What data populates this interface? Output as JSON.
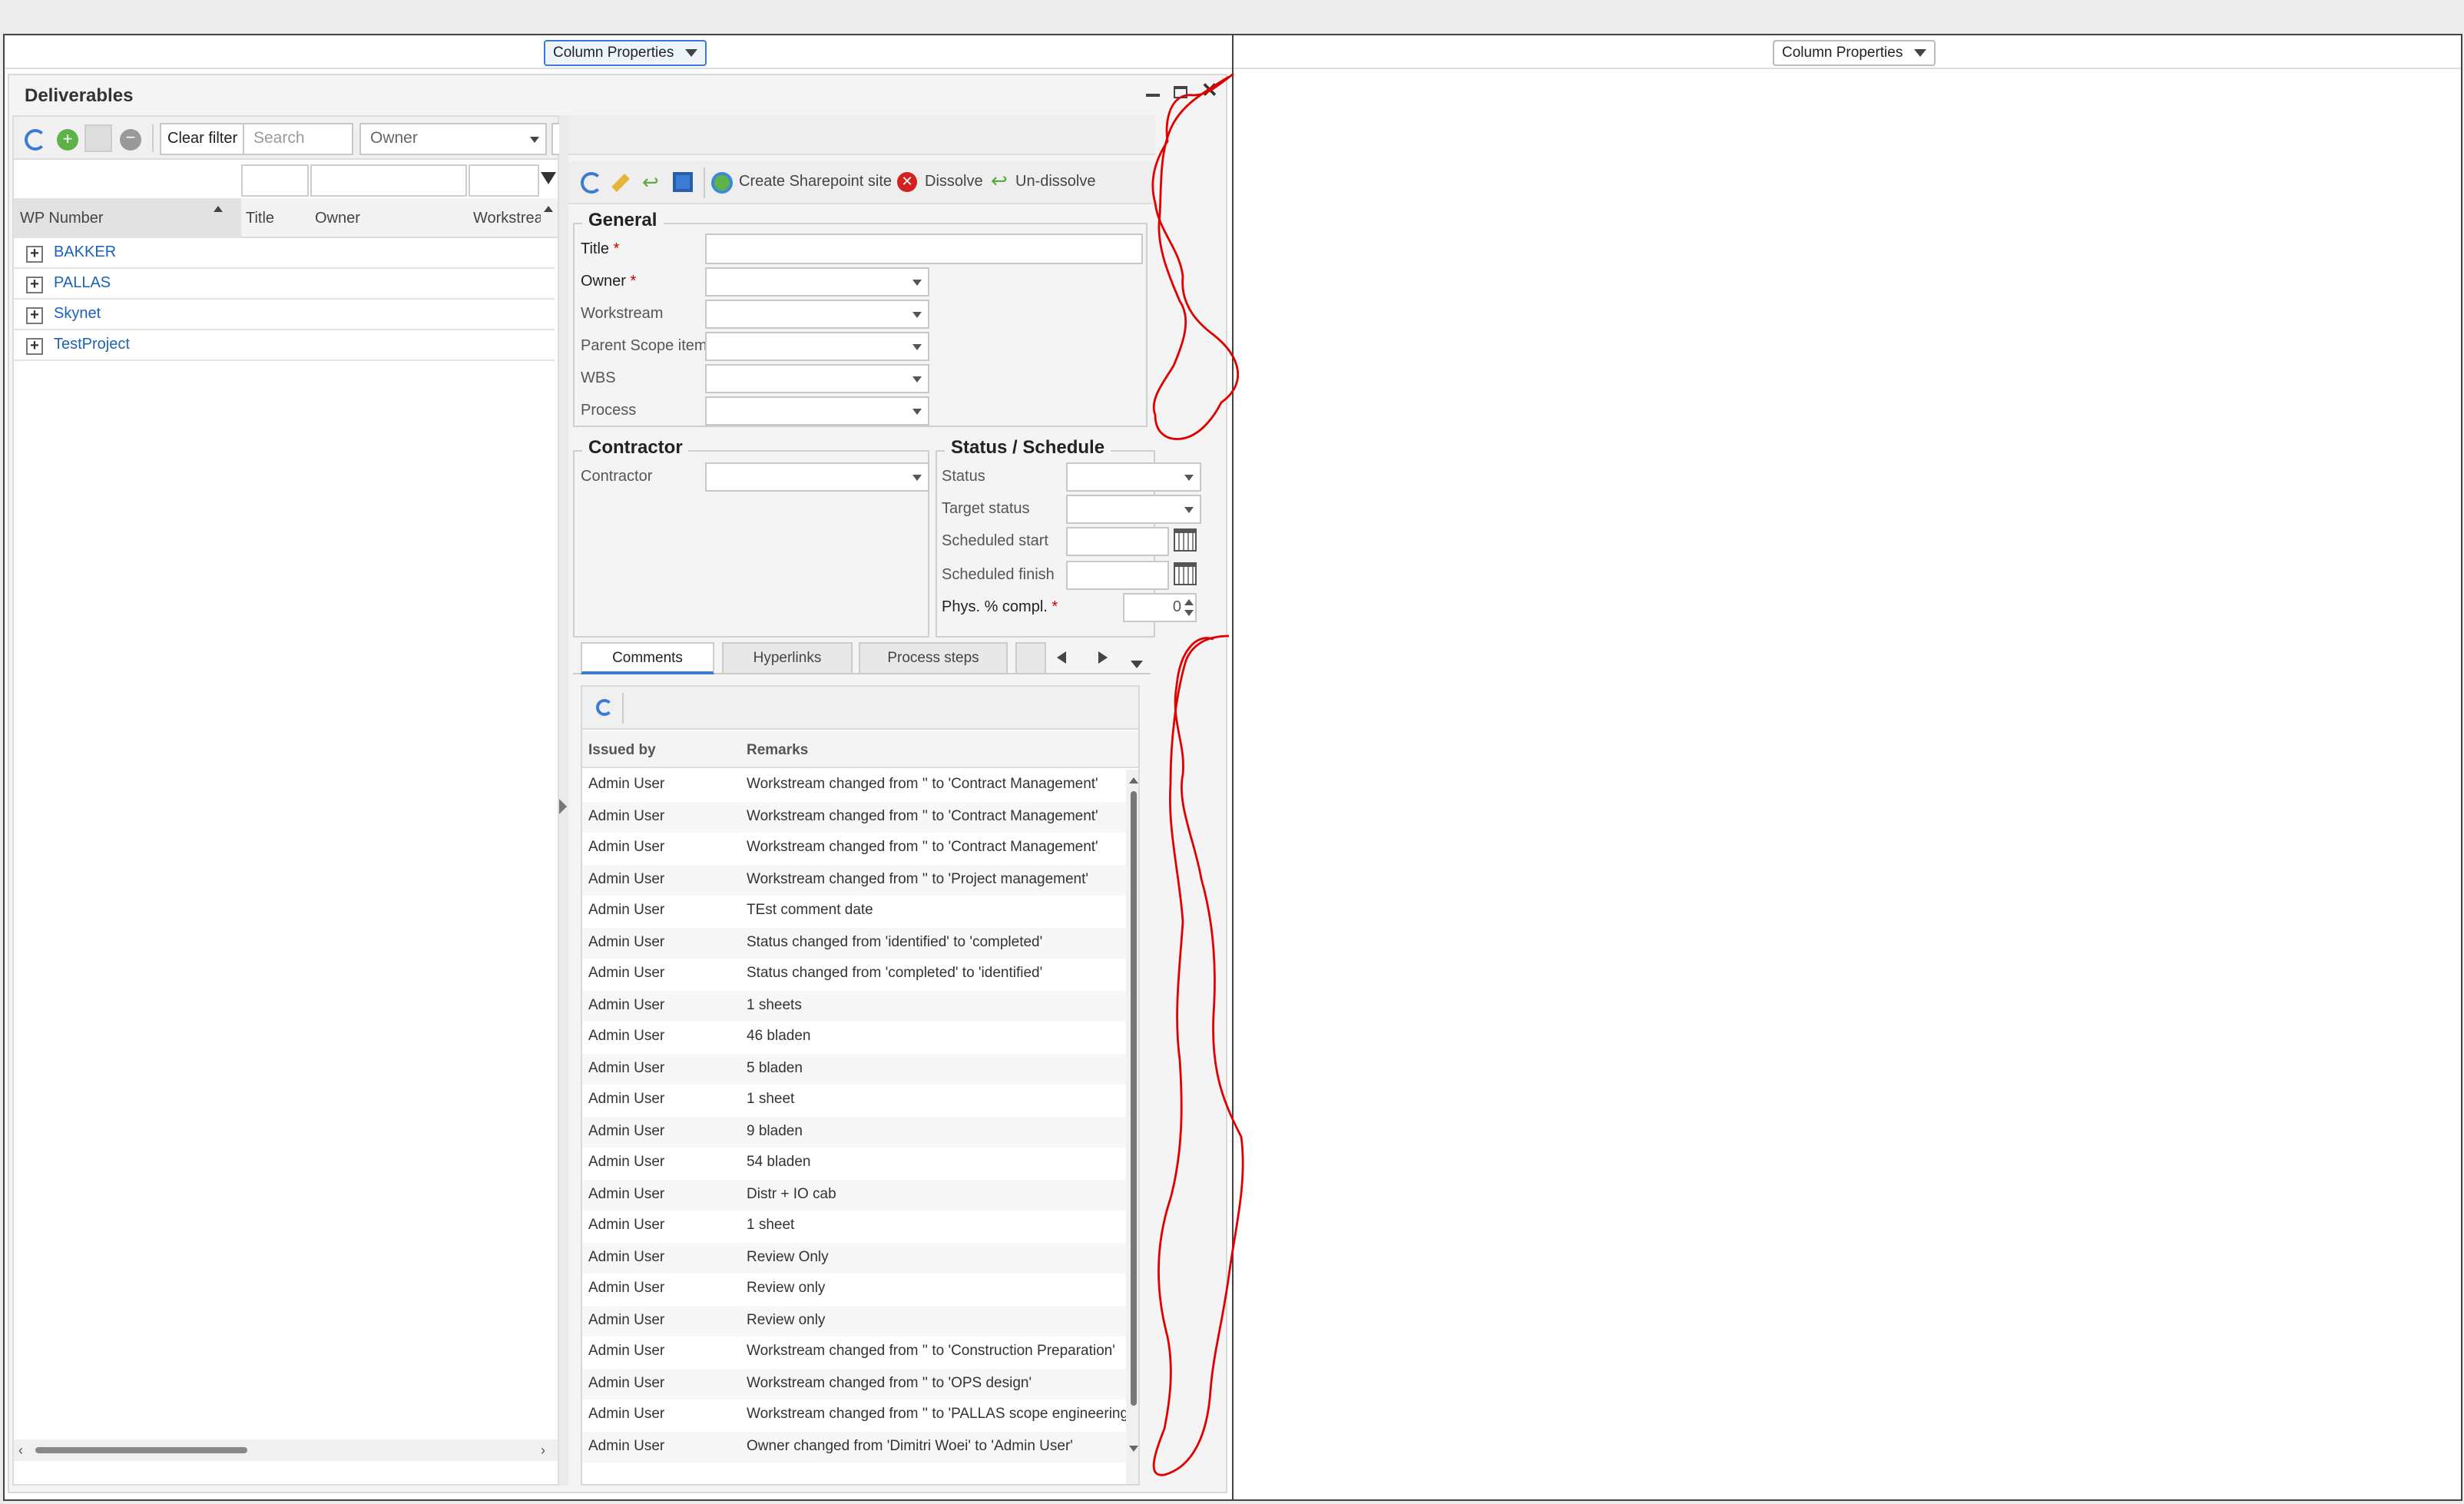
{
  "panels": {
    "left_column_properties": "Column Properties",
    "right_column_properties": "Column Properties"
  },
  "window": {
    "title": "Deliverables"
  },
  "list_toolbar": {
    "clear_filter": "Clear filter",
    "search_placeholder": "Search",
    "owner_filter": "Owner"
  },
  "tree": {
    "columns": [
      "WP Number",
      "Title",
      "Owner",
      "Workstrea"
    ],
    "items": [
      {
        "label": "BAKKER"
      },
      {
        "label": "PALLAS"
      },
      {
        "label": "Skynet"
      },
      {
        "label": "TestProject"
      }
    ]
  },
  "detail_toolbar": {
    "create_sharepoint": "Create Sharepoint site",
    "dissolve": "Dissolve",
    "undissolve": "Un-dissolve"
  },
  "general": {
    "title": "General",
    "fields": {
      "title": "Title",
      "owner": "Owner",
      "workstream": "Workstream",
      "parent_scope": "Parent Scope item",
      "wbs": "WBS",
      "process": "Process"
    },
    "required_mark": "*"
  },
  "contractor": {
    "title": "Contractor",
    "label": "Contractor"
  },
  "status": {
    "title": "Status / Schedule",
    "status": "Status",
    "target_status": "Target status",
    "scheduled_start": "Scheduled start",
    "scheduled_finish": "Scheduled finish",
    "phys_compl": "Phys. % compl.",
    "phys_value": "0"
  },
  "tabs": [
    "Comments",
    "Hyperlinks",
    "Process steps"
  ],
  "comments": {
    "headers": {
      "issued_by": "Issued by",
      "remarks": "Remarks"
    },
    "rows": [
      [
        "Admin User",
        "Workstream changed from '' to 'Contract Management'"
      ],
      [
        "Admin User",
        "Workstream changed from '' to 'Contract Management'"
      ],
      [
        "Admin User",
        "Workstream changed from '' to 'Contract Management'"
      ],
      [
        "Admin User",
        "Workstream changed from '' to 'Project management'"
      ],
      [
        "Admin User",
        "TEst comment date"
      ],
      [
        "Admin User",
        "Status changed from 'identified' to 'completed'"
      ],
      [
        "Admin User",
        "Status changed from 'completed' to 'identified'"
      ],
      [
        "Admin User",
        "1 sheets"
      ],
      [
        "Admin User",
        "46 bladen"
      ],
      [
        "Admin User",
        "5 bladen"
      ],
      [
        "Admin User",
        "1 sheet"
      ],
      [
        "Admin User",
        "9 bladen"
      ],
      [
        "Admin User",
        "54 bladen"
      ],
      [
        "Admin User",
        "Distr + IO cab"
      ],
      [
        "Admin User",
        "1 sheet"
      ],
      [
        "Admin User",
        "Review Only"
      ],
      [
        "Admin User",
        "Review only"
      ],
      [
        "Admin User",
        "Review only"
      ],
      [
        "Admin User",
        "Workstream changed from '' to 'Construction Preparation'"
      ],
      [
        "Admin User",
        "Workstream changed from '' to 'OPS design'"
      ],
      [
        "Admin User",
        "Workstream changed from '' to 'PALLAS scope engineering'"
      ],
      [
        "Admin User",
        "Owner changed from 'Dimitri Woei' to 'Admin User'"
      ]
    ]
  },
  "colors": {
    "annotation": "#e00000",
    "link": "#1b62b8",
    "accent": "#3b7bd4"
  }
}
